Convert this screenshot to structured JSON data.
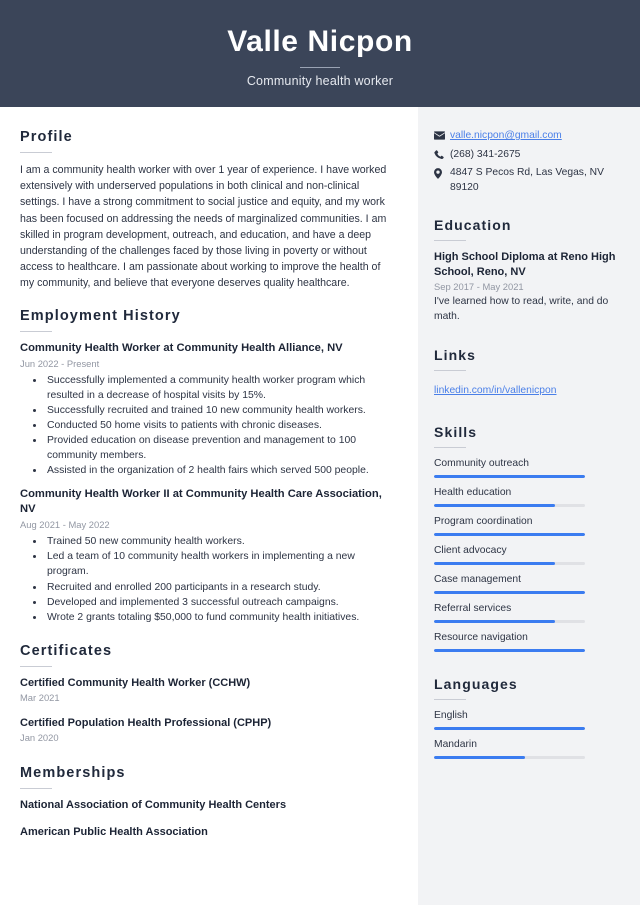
{
  "header": {
    "name": "Valle Nicpon",
    "job_title": "Community health worker",
    "background_color": "#3b4559"
  },
  "main": {
    "profile": {
      "heading": "Profile",
      "text": "I am a community health worker with over 1 year of experience. I have worked extensively with underserved populations in both clinical and non-clinical settings. I have a strong commitment to social justice and equity, and my work has been focused on addressing the needs of marginalized communities. I am skilled in program development, outreach, and education, and have a deep understanding of the challenges faced by those living in poverty or without access to healthcare. I am passionate about working to improve the health of my community, and believe that everyone deserves quality healthcare."
    },
    "employment": {
      "heading": "Employment History",
      "jobs": [
        {
          "title": "Community Health Worker at Community Health Alliance, NV",
          "date": "Jun 2022 - Present",
          "bullets": [
            "Successfully implemented a community health worker program which resulted in a decrease of hospital visits by 15%.",
            "Successfully recruited and trained 10 new community health workers.",
            "Conducted 50 home visits to patients with chronic diseases.",
            "Provided education on disease prevention and management to 100 community members.",
            "Assisted in the organization of 2 health fairs which served 500 people."
          ]
        },
        {
          "title": "Community Health Worker II at Community Health Care Association, NV",
          "date": "Aug 2021 - May 2022",
          "bullets": [
            "Trained 50 new community health workers.",
            "Led a team of 10 community health workers in implementing a new program.",
            "Recruited and enrolled 200 participants in a research study.",
            "Developed and implemented 3 successful outreach campaigns.",
            "Wrote 2 grants totaling $50,000 to fund community health initiatives."
          ]
        }
      ]
    },
    "certificates": {
      "heading": "Certificates",
      "items": [
        {
          "title": "Certified Community Health Worker (CCHW)",
          "date": "Mar 2021"
        },
        {
          "title": "Certified Population Health Professional (CPHP)",
          "date": "Jan 2020"
        }
      ]
    },
    "memberships": {
      "heading": "Memberships",
      "items": [
        {
          "title": "National Association of Community Health Centers"
        },
        {
          "title": "American Public Health Association"
        }
      ]
    }
  },
  "sidebar": {
    "contact": [
      {
        "icon": "envelope-icon",
        "text": "valle.nicpon@gmail.com",
        "is_link": true
      },
      {
        "icon": "phone-icon",
        "text": "(268) 341-2675",
        "is_link": false
      },
      {
        "icon": "location-pin-icon",
        "text": "4847 S Pecos Rd, Las Vegas, NV 89120",
        "is_link": false
      }
    ],
    "education": {
      "heading": "Education",
      "items": [
        {
          "title": "High School Diploma at Reno High School, Reno, NV",
          "date": "Sep 2017 - May 2021",
          "description": "I've learned how to read, write, and do math."
        }
      ]
    },
    "links": {
      "heading": "Links",
      "items": [
        {
          "text": "linkedin.com/in/vallenicpon"
        }
      ]
    },
    "skills": {
      "heading": "Skills",
      "items": [
        {
          "label": "Community outreach",
          "level": 100
        },
        {
          "label": "Health education",
          "level": 80
        },
        {
          "label": "Program coordination",
          "level": 100
        },
        {
          "label": "Client advocacy",
          "level": 80
        },
        {
          "label": "Case management",
          "level": 100
        },
        {
          "label": "Referral services",
          "level": 80
        },
        {
          "label": "Resource navigation",
          "level": 100
        }
      ]
    },
    "languages": {
      "heading": "Languages",
      "items": [
        {
          "label": "English",
          "level": 100
        },
        {
          "label": "Mandarin",
          "level": 60
        }
      ]
    },
    "accent_color": "#3b7cf0",
    "link_color": "#4a7fe8",
    "background_color": "#f2f3f5"
  }
}
